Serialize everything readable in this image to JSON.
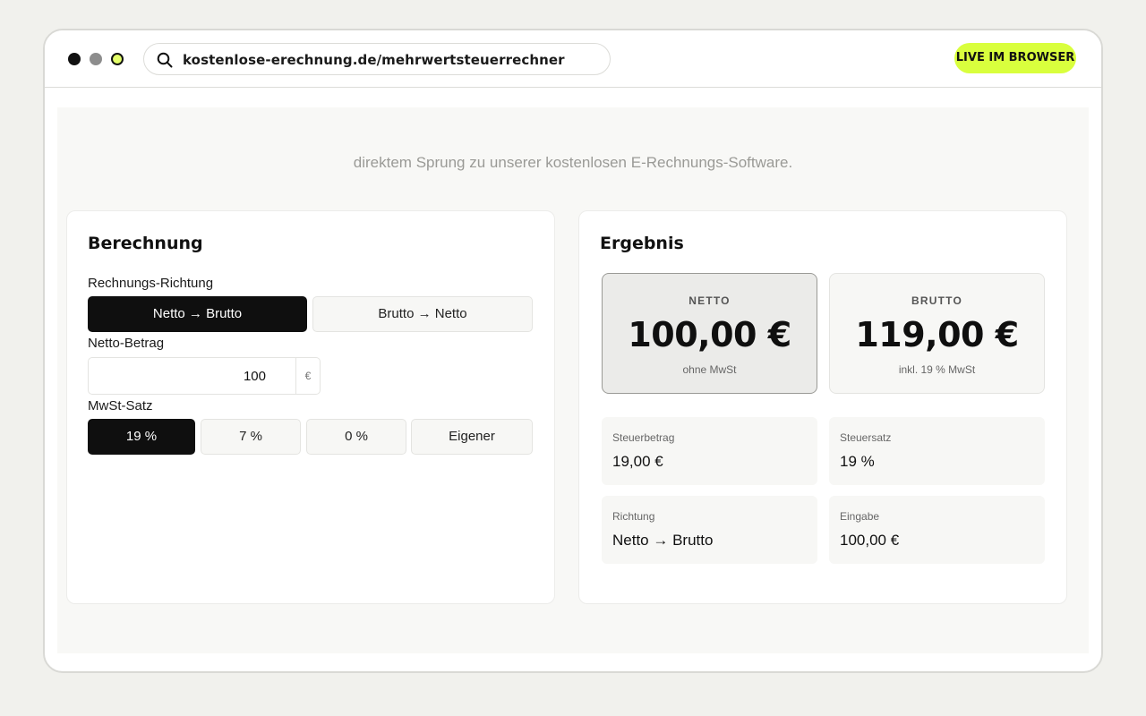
{
  "browser": {
    "url": "kostenlose-erechnung.de/mehrwertsteuerrechner",
    "badge": "LIVE IM BROWSER"
  },
  "page": {
    "subline": "direktem Sprung zu unserer kostenlosen E-Rechnungs-Software."
  },
  "calculation": {
    "title": "Berechnung",
    "direction_label": "Rechnungs-Richtung",
    "directions": [
      {
        "label": "Netto → Brutto",
        "active": true
      },
      {
        "label": "Brutto → Netto",
        "active": false
      }
    ],
    "amount_label": "Netto-Betrag",
    "amount_value": "100",
    "amount_unit": "€",
    "rate_label": "MwSt-Satz",
    "rates": [
      {
        "label": "19 %",
        "active": true
      },
      {
        "label": "7 %",
        "active": false
      },
      {
        "label": "0 %",
        "active": false
      },
      {
        "label": "Eigener",
        "active": false
      }
    ]
  },
  "result": {
    "title": "Ergebnis",
    "netto": {
      "label": "NETTO",
      "value": "100,00 €",
      "sub": "ohne MwSt"
    },
    "brutto": {
      "label": "BRUTTO",
      "value": "119,00 €",
      "sub": "inkl. 19 % MwSt"
    },
    "stats": [
      {
        "label": "Steuerbetrag",
        "value": "19,00 €"
      },
      {
        "label": "Steuersatz",
        "value": "19 %"
      },
      {
        "label": "Richtung",
        "value": "Netto → Brutto"
      },
      {
        "label": "Eingabe",
        "value": "100,00 €"
      }
    ]
  }
}
